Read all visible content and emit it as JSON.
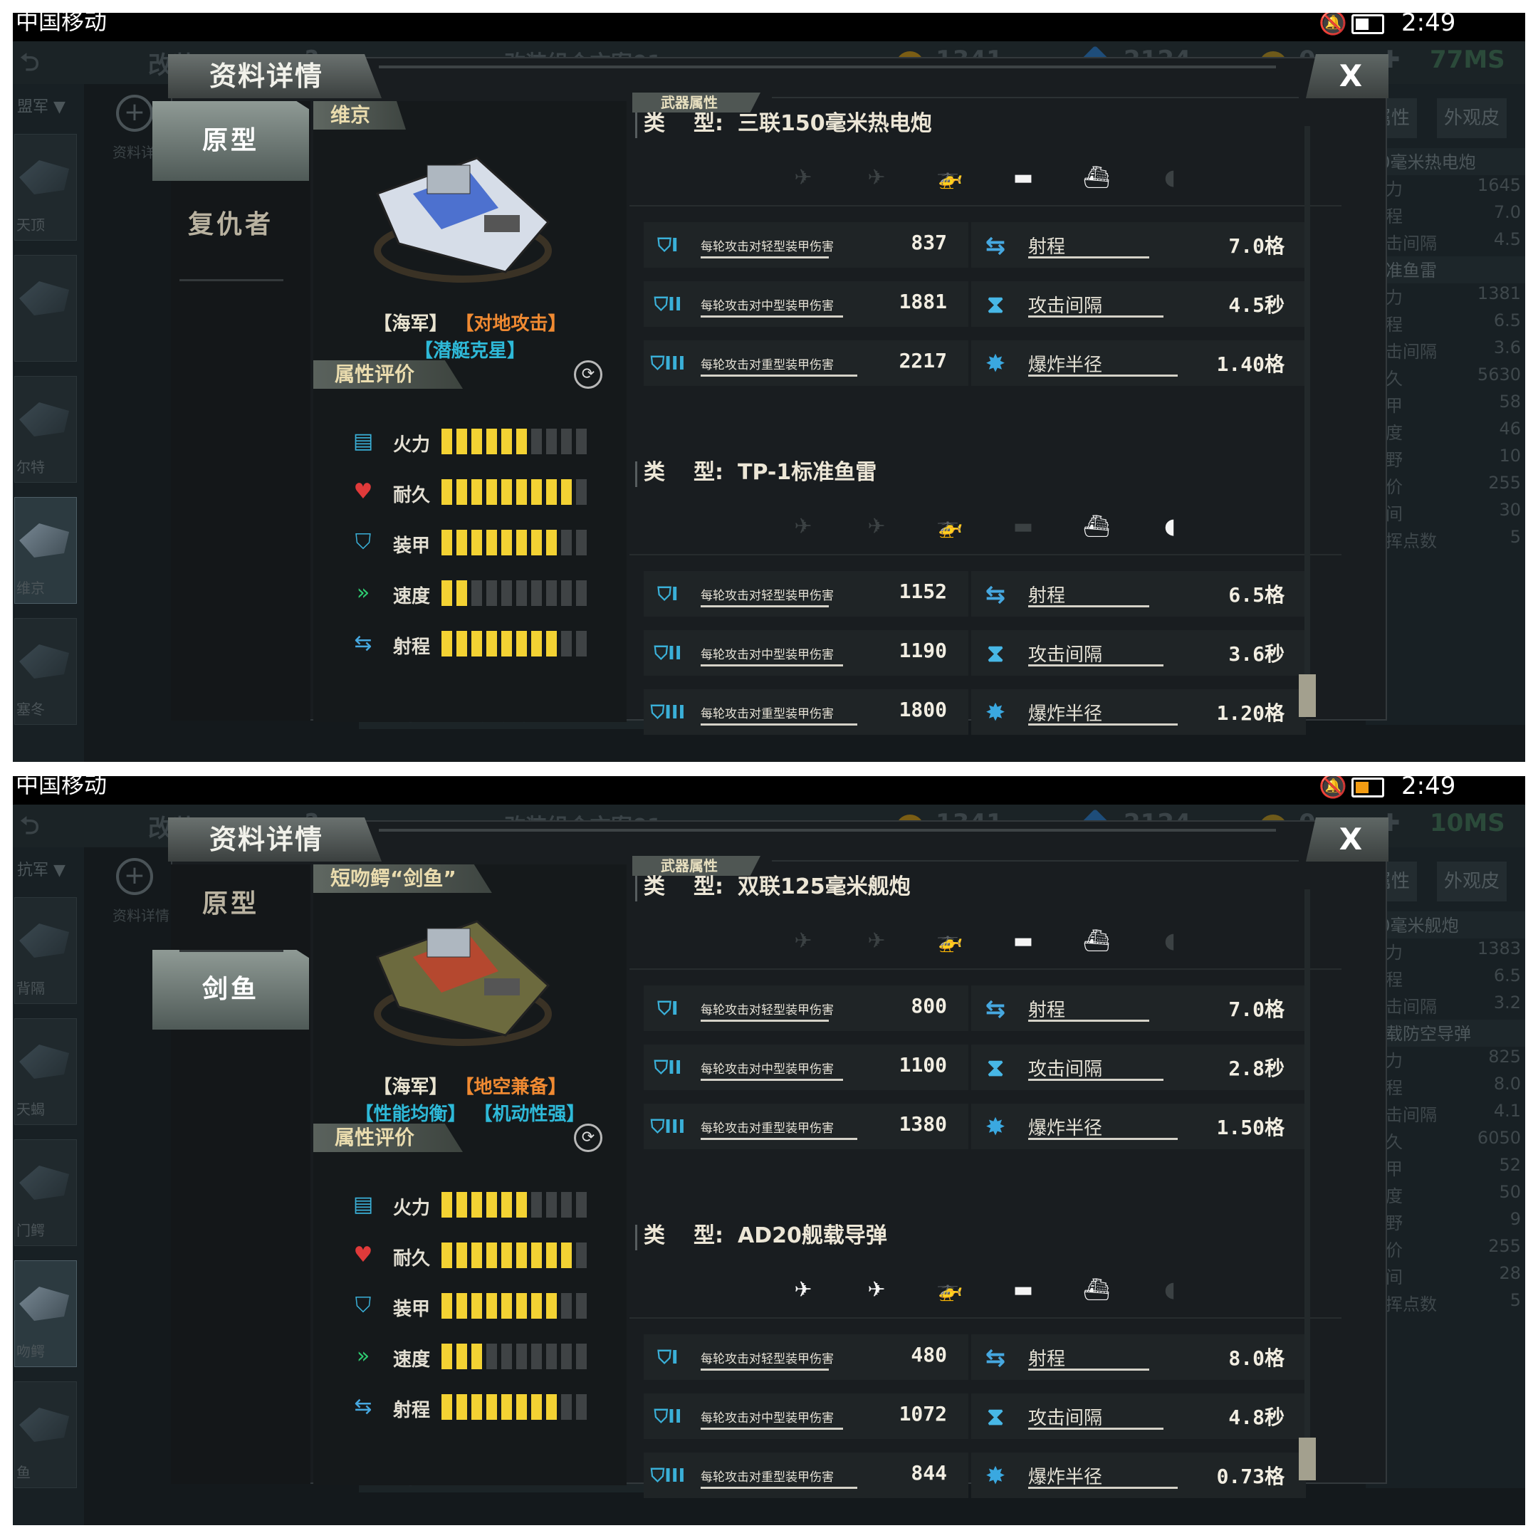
{
  "screens": [
    {
      "status": {
        "carrier": "中国移动",
        "time": "2:49"
      },
      "bg": {
        "title": "改装 1",
        "help": "?",
        "plan": "改装组合方案01",
        "gold": "1341",
        "gems": "2124",
        "other": "0",
        "sales": "77MS",
        "faction": "盟军",
        "zoom_label": "资料详",
        "thumbs": [
          "天顶",
          "",
          "尔特",
          "维京",
          "塞冬"
        ],
        "right_tabs": [
          "属性",
          "外观皮"
        ],
        "right_lines": [
          {
            "l": "50毫米热电炮",
            "v": "",
            "h": true
          },
          {
            "l": "火力",
            "v": "1645"
          },
          {
            "l": "射程",
            "v": "7.0"
          },
          {
            "l": "攻击间隔",
            "v": "4.5"
          },
          {
            "l": "标准鱼雷",
            "v": "",
            "h": true
          },
          {
            "l": "火力",
            "v": "1381"
          },
          {
            "l": "射程",
            "v": "6.5"
          },
          {
            "l": "攻击间隔",
            "v": "3.6"
          },
          {
            "l": "耐久",
            "v": "5630"
          },
          {
            "l": "装甲",
            "v": "58"
          },
          {
            "l": "速度",
            "v": "46"
          },
          {
            "l": "视野",
            "v": "10"
          },
          {
            "l": "造价",
            "v": "255"
          },
          {
            "l": "时间",
            "v": "30"
          },
          {
            "l": "指挥点数",
            "v": "5"
          }
        ],
        "bottom": [
          "原型",
          "复仇者"
        ]
      },
      "dialog": {
        "title": "资料详情",
        "close": "X",
        "tabs": [
          "原型",
          "复仇者"
        ],
        "active_tab": 0,
        "ship": {
          "name": "维京",
          "tags_row1": [
            {
              "t": "【海军】",
              "c": "w"
            },
            {
              "t": "【对地攻击】",
              "c": "o"
            }
          ],
          "tags_row2": [
            {
              "t": "【潜艇克星】",
              "c": "b"
            }
          ],
          "hull": "#d6dde8",
          "accent": "#2b56c8"
        },
        "attr_header": "属性评价",
        "attrs": [
          {
            "label": "火力",
            "icon": "firepower-icon",
            "level": 6
          },
          {
            "label": "耐久",
            "icon": "heart-icon",
            "level": 9
          },
          {
            "label": "装甲",
            "icon": "armor-icon",
            "level": 8
          },
          {
            "label": "速度",
            "icon": "speed-icon",
            "level": 2
          },
          {
            "label": "射程",
            "icon": "range-icon",
            "level": 8
          }
        ],
        "weapon_header": "武器属性",
        "weapons": [
          {
            "type_key": "类",
            "type_key2": "型:",
            "type_name": "三联150毫米热电炮",
            "targets": [
              false,
              false,
              false,
              true,
              true,
              false
            ],
            "stats_left": [
              {
                "label": "每轮攻击对轻型装甲伤害",
                "value": "837",
                "tier": "I"
              },
              {
                "label": "每轮攻击对中型装甲伤害",
                "value": "1881",
                "tier": "II"
              },
              {
                "label": "每轮攻击对重型装甲伤害",
                "value": "2217",
                "tier": "III"
              }
            ],
            "stats_right": [
              {
                "label": "射程",
                "value": "7.0格"
              },
              {
                "label": "攻击间隔",
                "value": "4.5秒"
              },
              {
                "label": "爆炸半径",
                "value": "1.40格"
              }
            ]
          },
          {
            "type_key": "类",
            "type_key2": "型:",
            "type_name": "TP-1标准鱼雷",
            "targets": [
              false,
              false,
              false,
              false,
              true,
              true
            ],
            "stats_left": [
              {
                "label": "每轮攻击对轻型装甲伤害",
                "value": "1152",
                "tier": "I"
              },
              {
                "label": "每轮攻击对中型装甲伤害",
                "value": "1190",
                "tier": "II"
              },
              {
                "label": "每轮攻击对重型装甲伤害",
                "value": "1800",
                "tier": "III"
              }
            ],
            "stats_right": [
              {
                "label": "射程",
                "value": "6.5格"
              },
              {
                "label": "攻击间隔",
                "value": "3.6秒"
              },
              {
                "label": "爆炸半径",
                "value": "1.20格"
              }
            ]
          }
        ]
      }
    },
    {
      "status": {
        "carrier": "中国移动",
        "time": "2:49"
      },
      "bg": {
        "title": "改装 1",
        "help": "?",
        "plan": "改装组合方案01",
        "gold": "1341",
        "gems": "2124",
        "other": "0",
        "sales": "10MS",
        "faction": "抗军",
        "zoom_label": "资料详情",
        "thumbs": [
          "背隔",
          "天蝎",
          "门鳄",
          "吻鳄",
          "鱼"
        ],
        "right_tabs": [
          "属性",
          "外观皮"
        ],
        "right_lines": [
          {
            "l": "30毫米舰炮",
            "v": "",
            "h": true
          },
          {
            "l": "火力",
            "v": "1383"
          },
          {
            "l": "射程",
            "v": "6.5"
          },
          {
            "l": "攻击间隔",
            "v": "3.2"
          },
          {
            "l": "舰载防空导弹",
            "v": "",
            "h": true
          },
          {
            "l": "火力",
            "v": "825"
          },
          {
            "l": "射程",
            "v": "8.0"
          },
          {
            "l": "攻击间隔",
            "v": "4.1"
          },
          {
            "l": "耐久",
            "v": "6050"
          },
          {
            "l": "装甲",
            "v": "52"
          },
          {
            "l": "速度",
            "v": "50"
          },
          {
            "l": "视野",
            "v": "9"
          },
          {
            "l": "造价",
            "v": "255"
          },
          {
            "l": "时间",
            "v": "28"
          },
          {
            "l": "指挥点数",
            "v": "5"
          }
        ],
        "bottom": [
          "原型",
          "剑鱼"
        ]
      },
      "dialog": {
        "title": "资料详情",
        "close": "X",
        "tabs": [
          "原型",
          "剑鱼"
        ],
        "active_tab": 1,
        "ship": {
          "name": "短吻鳄“剑鱼”",
          "tags_row1": [
            {
              "t": "【海军】",
              "c": "w"
            },
            {
              "t": "【地空兼备】",
              "c": "o"
            }
          ],
          "tags_row2": [
            {
              "t": "【性能均衡】",
              "c": "b"
            },
            {
              "t": "【机动性强】",
              "c": "b"
            }
          ],
          "hull": "#6c6a3e",
          "accent": "#c8402c"
        },
        "attr_header": "属性评价",
        "attrs": [
          {
            "label": "火力",
            "icon": "firepower-icon",
            "level": 6
          },
          {
            "label": "耐久",
            "icon": "heart-icon",
            "level": 9
          },
          {
            "label": "装甲",
            "icon": "armor-icon",
            "level": 8
          },
          {
            "label": "速度",
            "icon": "speed-icon",
            "level": 3
          },
          {
            "label": "射程",
            "icon": "range-icon",
            "level": 8
          }
        ],
        "weapon_header": "武器属性",
        "weapons": [
          {
            "type_key": "类",
            "type_key2": "型:",
            "type_name": "双联125毫米舰炮",
            "targets": [
              false,
              false,
              false,
              true,
              true,
              false
            ],
            "stats_left": [
              {
                "label": "每轮攻击对轻型装甲伤害",
                "value": "800",
                "tier": "I"
              },
              {
                "label": "每轮攻击对中型装甲伤害",
                "value": "1100",
                "tier": "II"
              },
              {
                "label": "每轮攻击对重型装甲伤害",
                "value": "1380",
                "tier": "III"
              }
            ],
            "stats_right": [
              {
                "label": "射程",
                "value": "7.0格"
              },
              {
                "label": "攻击间隔",
                "value": "2.8秒"
              },
              {
                "label": "爆炸半径",
                "value": "1.50格"
              }
            ]
          },
          {
            "type_key": "类",
            "type_key2": "型:",
            "type_name": "AD20舰载导弹",
            "targets": [
              true,
              true,
              true,
              true,
              true,
              false
            ],
            "stats_left": [
              {
                "label": "每轮攻击对轻型装甲伤害",
                "value": "480",
                "tier": "I"
              },
              {
                "label": "每轮攻击对中型装甲伤害",
                "value": "1072",
                "tier": "II"
              },
              {
                "label": "每轮攻击对重型装甲伤害",
                "value": "844",
                "tier": "III"
              }
            ],
            "stats_right": [
              {
                "label": "射程",
                "value": "8.0格"
              },
              {
                "label": "攻击间隔",
                "value": "4.8秒"
              },
              {
                "label": "爆炸半径",
                "value": "0.73格"
              }
            ]
          }
        ]
      }
    }
  ],
  "target_icons": [
    "jet-icon",
    "plane-icon",
    "helicopter-icon",
    "tank-icon",
    "ship-icon",
    "submarine-icon"
  ],
  "target_glyphs": [
    "✈",
    "✈",
    "🚁",
    "▬",
    "⛴",
    "◖"
  ]
}
